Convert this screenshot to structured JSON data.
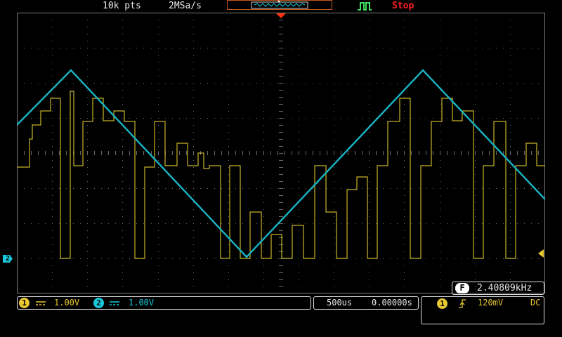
{
  "header": {
    "points": "10k pts",
    "sample_rate": "2MSa/s",
    "status": "Stop"
  },
  "colors": {
    "ch1": "#e8c832",
    "ch2": "#18c8dc",
    "stop": "#ff2020",
    "grid": "#6a6a6a"
  },
  "markers": {
    "ch2_ground": "2"
  },
  "frequency": {
    "badge": "F",
    "value": "2.40809kHz"
  },
  "channels": [
    {
      "id": "1",
      "coupling_icon": "dc-coupling-icon",
      "scale": "1.00V"
    },
    {
      "id": "2",
      "coupling_icon": "dc-coupling-icon",
      "scale": "1.00V"
    }
  ],
  "timebase": {
    "scale": "500us",
    "delay": "0.00000s"
  },
  "trigger": {
    "source": "1",
    "edge_icon": "rising-edge-icon",
    "level": "120mV",
    "coupling": "DC"
  }
}
